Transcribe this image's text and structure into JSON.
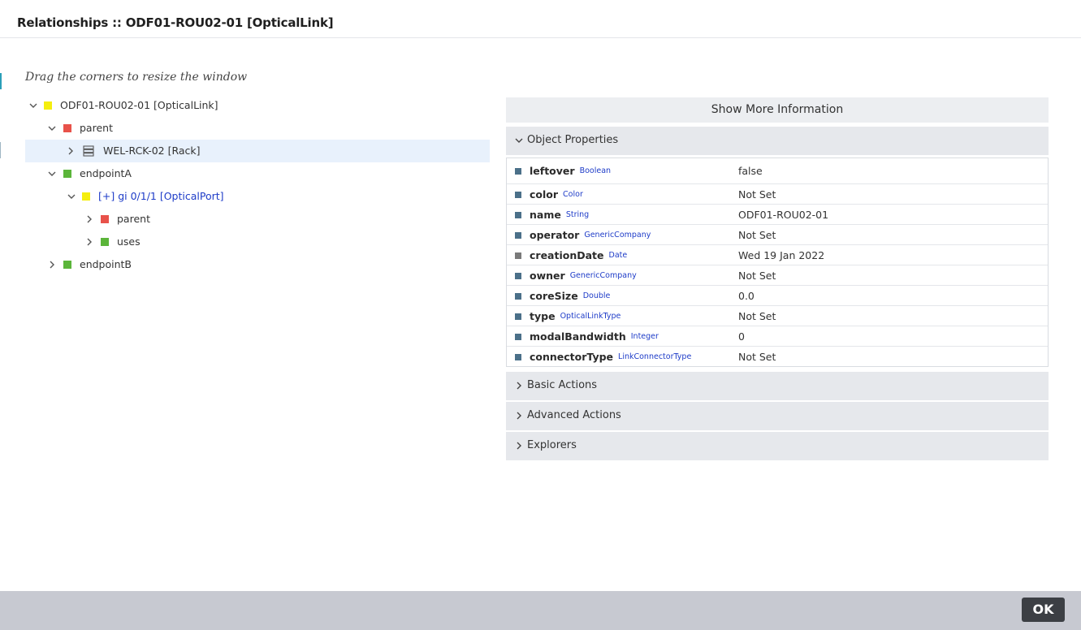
{
  "title": "Relationships :: ODF01-ROU02-01 [OpticalLink]",
  "hint": "Drag the corners to resize the window",
  "tree": {
    "root": "ODF01-ROU02-01 [OpticalLink]",
    "parent": "parent",
    "rack": "WEL-RCK-02 [Rack]",
    "endpointA": "endpointA",
    "port": "[+] gi 0/1/1 [OpticalPort]",
    "port_parent": "parent",
    "port_uses": "uses",
    "endpointB": "endpointB"
  },
  "colors": {
    "yellow": "#f5ee0e",
    "red": "#e8524a",
    "green": "#5bb53a",
    "selected": "#e8f1fc",
    "accent": "#1e3cc8"
  },
  "panel": {
    "show_more": "Show More Information",
    "object_properties": "Object Properties",
    "basic_actions": "Basic Actions",
    "advanced_actions": "Advanced Actions",
    "explorers": "Explorers"
  },
  "properties": [
    {
      "name": "leftover",
      "type": "Boolean",
      "value": "false"
    },
    {
      "name": "color",
      "type": "Color",
      "value": "Not Set"
    },
    {
      "name": "name",
      "type": "String",
      "value": "ODF01-ROU02-01"
    },
    {
      "name": "operator",
      "type": "GenericCompany",
      "value": "Not Set"
    },
    {
      "name": "creationDate",
      "type": "Date",
      "value": "Wed 19 Jan 2022"
    },
    {
      "name": "owner",
      "type": "GenericCompany",
      "value": "Not Set"
    },
    {
      "name": "coreSize",
      "type": "Double",
      "value": "0.0"
    },
    {
      "name": "type",
      "type": "OpticalLinkType",
      "value": "Not Set"
    },
    {
      "name": "modalBandwidth",
      "type": "Integer",
      "value": "0"
    },
    {
      "name": "connectorType",
      "type": "LinkConnectorType",
      "value": "Not Set"
    }
  ],
  "footer": {
    "ok_label": "OK"
  }
}
